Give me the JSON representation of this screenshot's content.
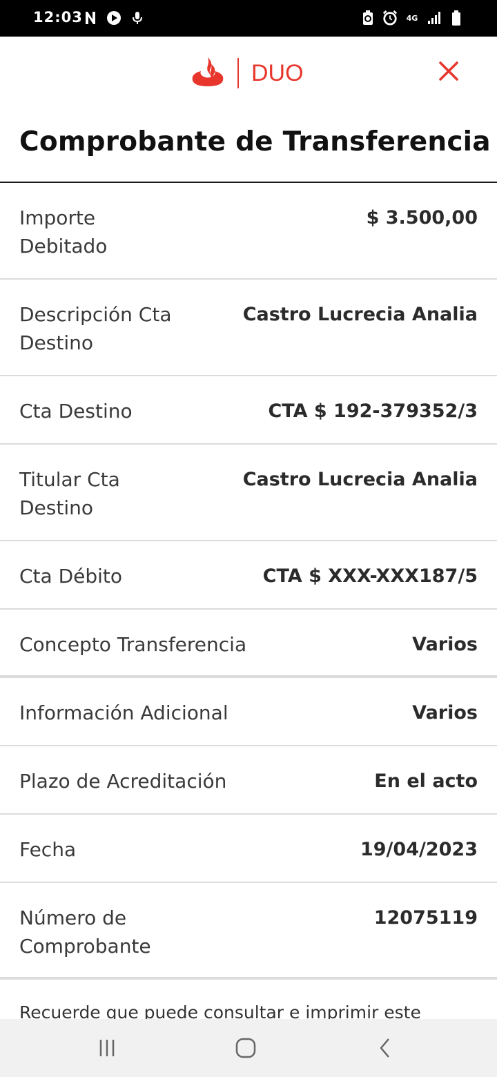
{
  "status_bar": {
    "time": "12:03",
    "network": "4G",
    "icons": [
      "n-icon",
      "play-icon",
      "mic-icon",
      "battery-saver-icon",
      "alarm-icon",
      "signal-icon",
      "battery-icon"
    ]
  },
  "header": {
    "brand": "DUO",
    "title": "Comprobante de Transferencia",
    "accent_color": "#e8362c"
  },
  "rows": [
    {
      "label": "Importe Debitado",
      "value": "$ 3.500,00"
    },
    {
      "label": "Descripción Cta Destino",
      "value": "Castro Lucrecia Analia"
    },
    {
      "label": "Cta Destino",
      "value": "CTA $ 192-379352/3"
    },
    {
      "label": "Titular Cta Destino",
      "value": "Castro Lucrecia Analia"
    },
    {
      "label": "Cta Débito",
      "value": "CTA $ XXX-XXX187/5"
    },
    {
      "label": "Concepto Transferencia",
      "value": "Varios"
    },
    {
      "label": "Información Adicional",
      "value": "Varios"
    },
    {
      "label": "Plazo de Acreditación",
      "value": "En el acto"
    },
    {
      "label": "Fecha",
      "value": "19/04/2023"
    },
    {
      "label": "Número de Comprobante",
      "value": "12075119"
    }
  ],
  "footer": {
    "note": "Recuerde que puede consultar e imprimir este"
  },
  "nav": {
    "icons": [
      "recent-apps-icon",
      "home-icon",
      "back-icon"
    ]
  }
}
